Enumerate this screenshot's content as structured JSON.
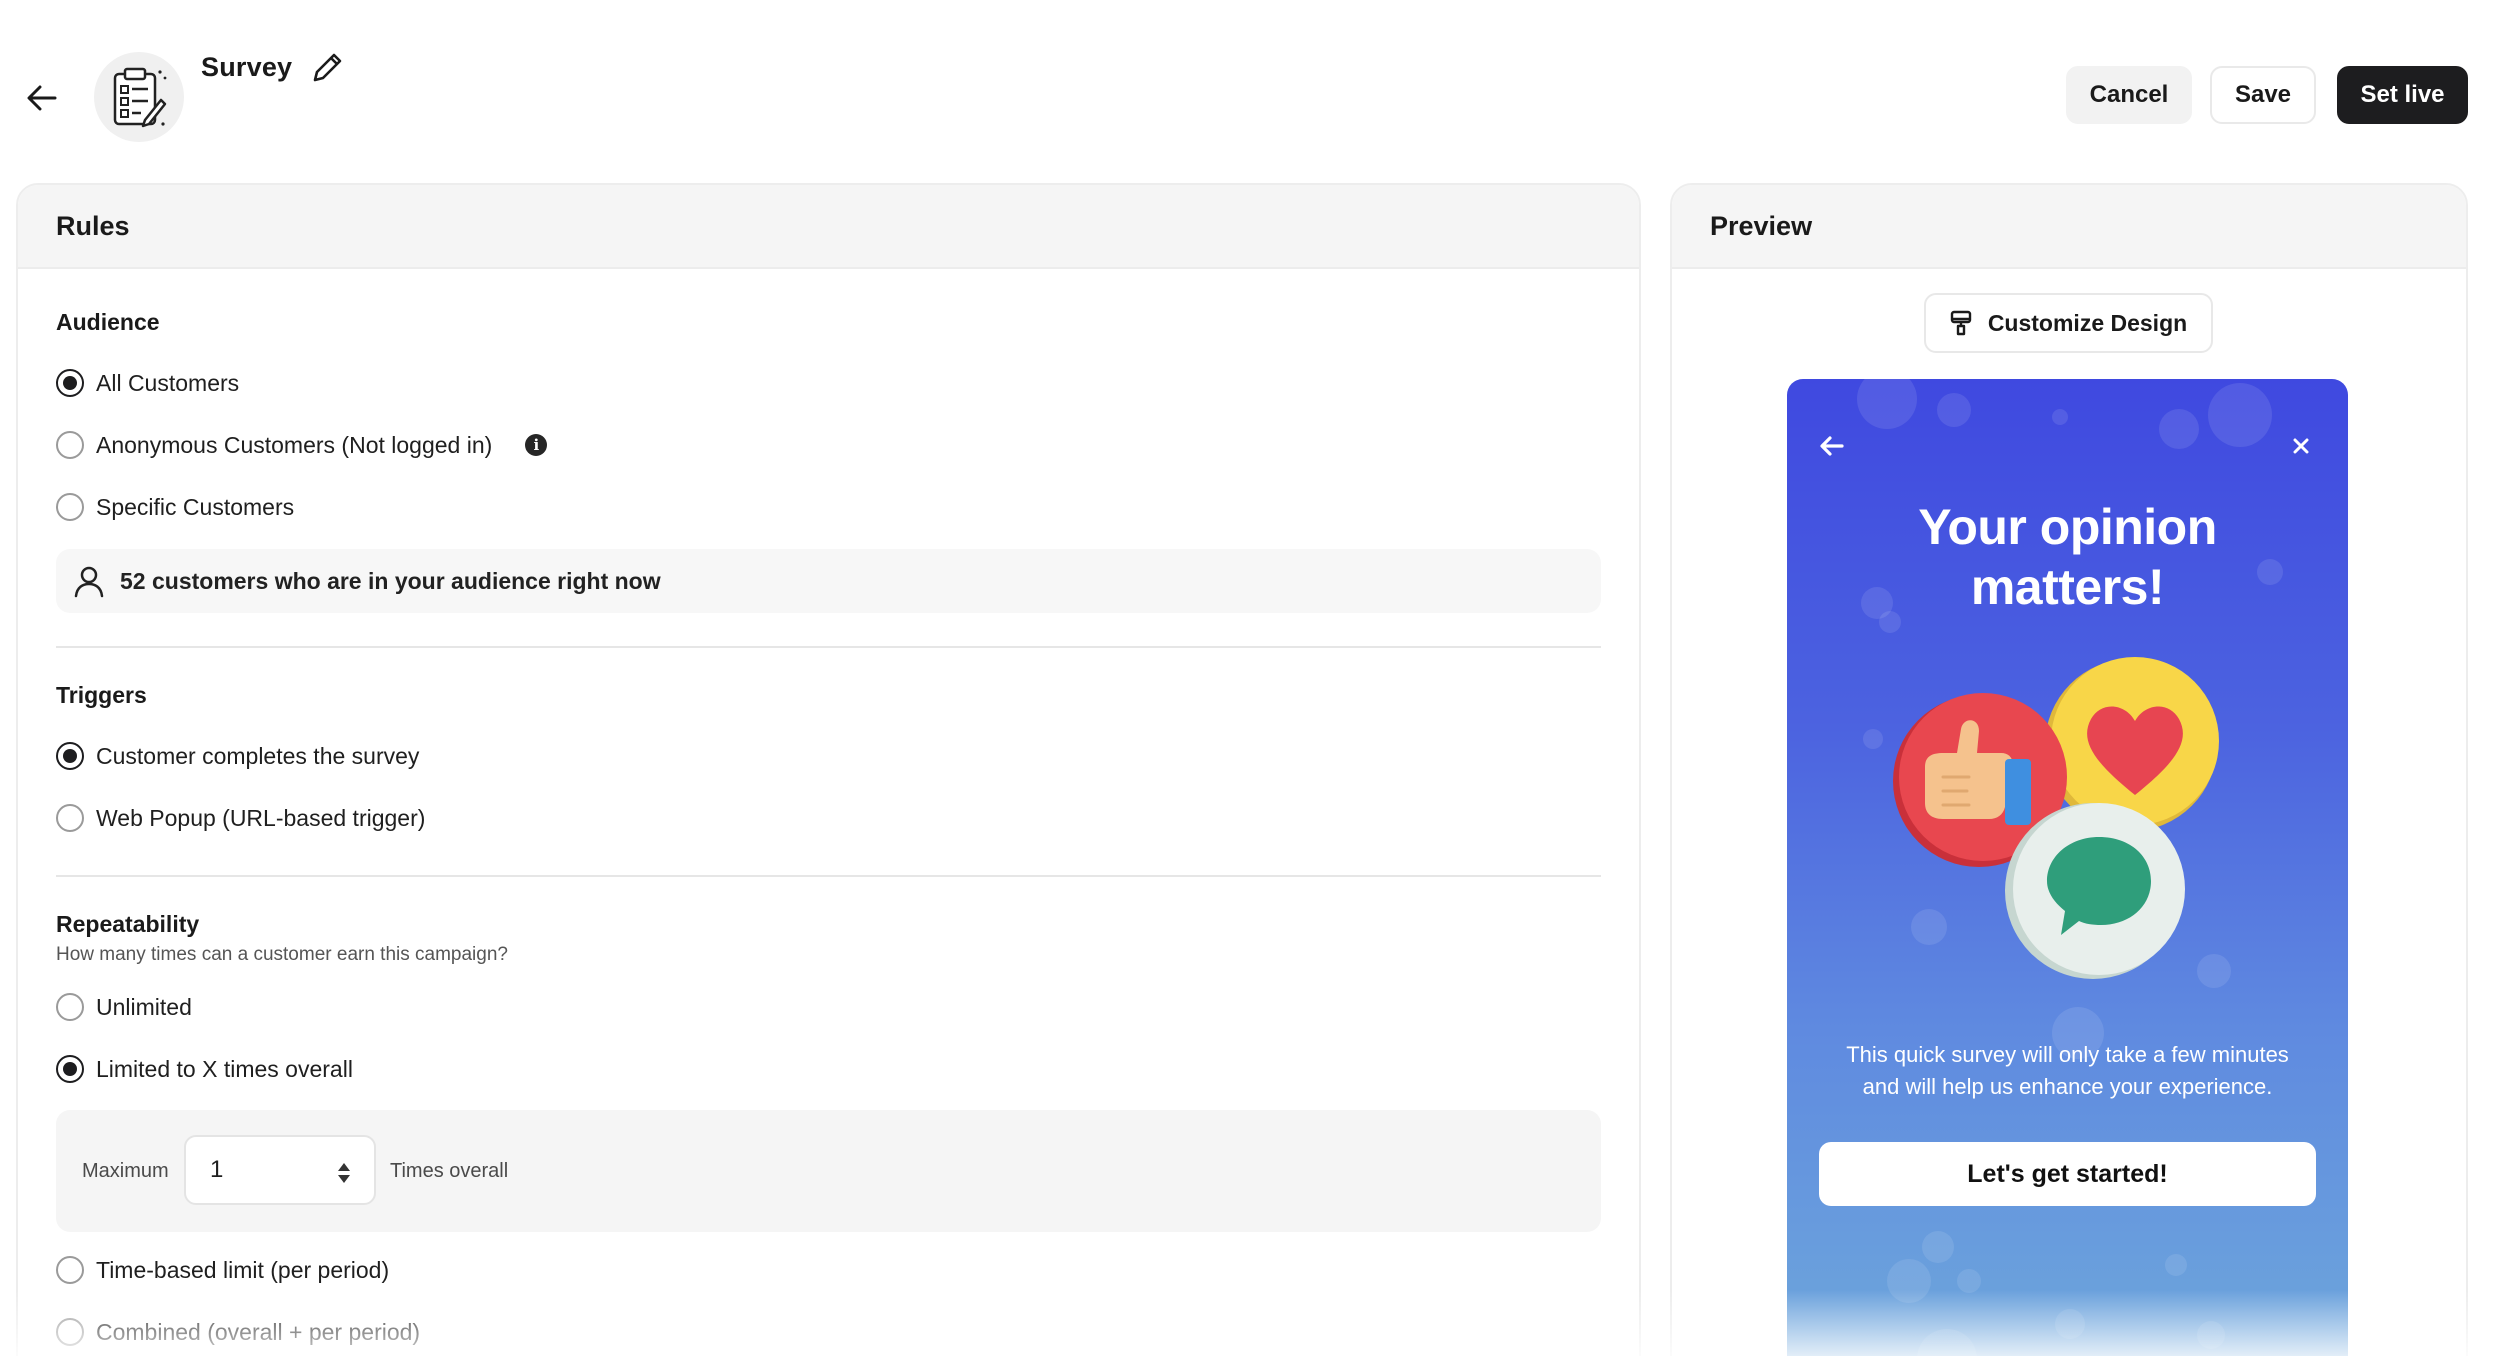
{
  "header": {
    "title": "Survey",
    "buttons": {
      "cancel": "Cancel",
      "save": "Save",
      "set_live": "Set live"
    }
  },
  "rules": {
    "panel_title": "Rules",
    "audience": {
      "title": "Audience",
      "options": [
        {
          "label": "All Customers",
          "selected": true
        },
        {
          "label": "Anonymous Customers (Not logged in)",
          "selected": false
        },
        {
          "label": "Specific Customers",
          "selected": false
        }
      ],
      "info_glyph": "i",
      "summary": "52 customers who are in your audience right now"
    },
    "triggers": {
      "title": "Triggers",
      "options": [
        {
          "label": "Customer completes the survey",
          "selected": true
        },
        {
          "label": "Web Popup (URL-based trigger)",
          "selected": false
        }
      ]
    },
    "repeatability": {
      "title": "Repeatability",
      "subtitle": "How many times can a customer earn this campaign?",
      "options": [
        {
          "label": "Unlimited",
          "selected": false
        },
        {
          "label": "Limited to X times overall",
          "selected": true
        },
        {
          "label": "Time-based limit (per period)",
          "selected": false
        },
        {
          "label": "Combined (overall + per period)",
          "selected": false
        }
      ],
      "maximum_label": "Maximum",
      "maximum_value": "1",
      "times_label": "Times overall"
    }
  },
  "preview": {
    "panel_title": "Preview",
    "customize_label": "Customize Design",
    "card": {
      "title_line1": "Your opinion",
      "title_line2": "matters!",
      "desc_line1": "This quick survey will only take a few minutes",
      "desc_line2": "and will help us enhance your experience.",
      "cta": "Let's get started!",
      "close_glyph": "×"
    }
  },
  "colors": {
    "primary_dark": "#1d1d1f",
    "panel_header_bg": "#f5f5f5",
    "preview_gradient_top": "#3f49e0",
    "preview_gradient_bottom": "#6ea8db",
    "thumb_red": "#e8474f",
    "heart_yellow": "#f8d648",
    "chat_green": "#2f9e7b"
  },
  "icons": [
    "arrow-left-icon",
    "clipboard-survey-icon",
    "pencil-icon",
    "info-icon",
    "user-icon",
    "stepper-icon",
    "paint-brush-icon",
    "close-icon"
  ]
}
